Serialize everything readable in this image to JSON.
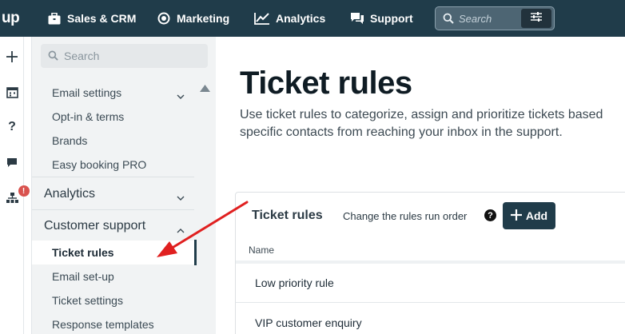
{
  "topnav": {
    "logo": "up",
    "items": [
      {
        "label": "Sales & CRM",
        "icon": "briefcase-icon"
      },
      {
        "label": "Marketing",
        "icon": "target-icon"
      },
      {
        "label": "Analytics",
        "icon": "line-chart-icon"
      },
      {
        "label": "Support",
        "icon": "chat-bubbles-icon"
      }
    ],
    "search_placeholder": "Search"
  },
  "rail": {
    "icons": [
      "plus-icon",
      "calendar-icon",
      "help-icon",
      "chat-icon",
      "sitemap-icon"
    ],
    "badge": "!"
  },
  "sidebar": {
    "search_placeholder": "Search",
    "sections": {
      "email_settings": "Email settings",
      "opt_in": "Opt-in & terms",
      "brands": "Brands",
      "easy_booking": "Easy booking PRO",
      "analytics": "Analytics",
      "customer_support": "Customer support",
      "ticket_rules": "Ticket rules",
      "email_setup": "Email set-up",
      "ticket_settings": "Ticket settings",
      "response_templates": "Response templates"
    }
  },
  "main": {
    "title": "Ticket rules",
    "description_line1": "Use ticket rules to categorize, assign and prioritize tickets based",
    "description_line2": "specific contacts from reaching your inbox in the support.",
    "panel": {
      "title": "Ticket rules",
      "run_order_link": "Change the rules run order",
      "help": "?",
      "add_label": "Add",
      "column_name": "Name",
      "rules": [
        "Low priority rule",
        "VIP customer enquiry"
      ]
    }
  },
  "colors": {
    "topbar": "#203c4a",
    "accent": "#203c4a",
    "arrow": "#e02020",
    "badge": "#d9534f"
  }
}
